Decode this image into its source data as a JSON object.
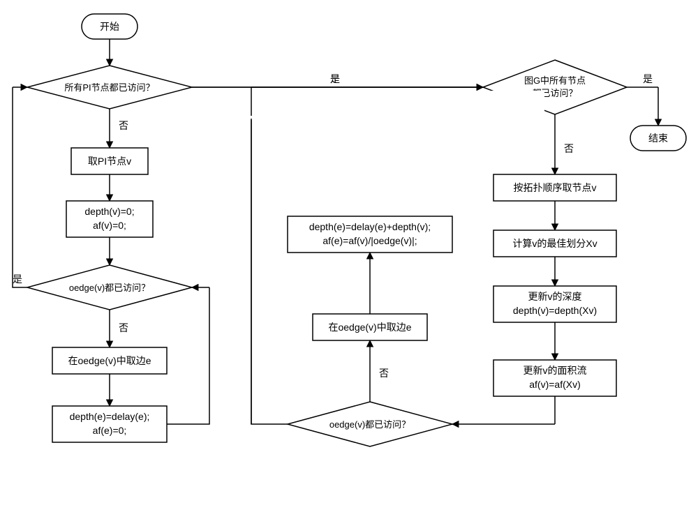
{
  "nodes": {
    "start": "开始",
    "end": "结束",
    "d1": "所有PI节点都已访问？",
    "d2_line1": "图G中所有节点",
    "d2_line2": "都已访问？",
    "d3": "oedge(v)都已访问？",
    "d4": "oedge(v)都已访问？",
    "p1": "取PI节点v",
    "p2_line1": "depth(v)=0;",
    "p2_line2": "af(v)=0;",
    "p3": "在oedge(v)中取边e",
    "p4_line1": "depth(e)=delay(e);",
    "p4_line2": "af(e)=0;",
    "p5": "按拓扑顺序取节点v",
    "p6": "计算v的最佳划分Xv",
    "p7_line1": "更新v的深度",
    "p7_line2": "depth(v)=depth(Xv)",
    "p8_line1": "更新v的面积流",
    "p8_line2": "af(v)=af(Xv)",
    "p9": "在oedge(v)中取边e",
    "p10_line1": "depth(e)=delay(e)+depth(v);",
    "p10_line2": "af(e)=af(v)/|oedge(v)|;"
  },
  "labels": {
    "yes": "是",
    "no": "否"
  }
}
